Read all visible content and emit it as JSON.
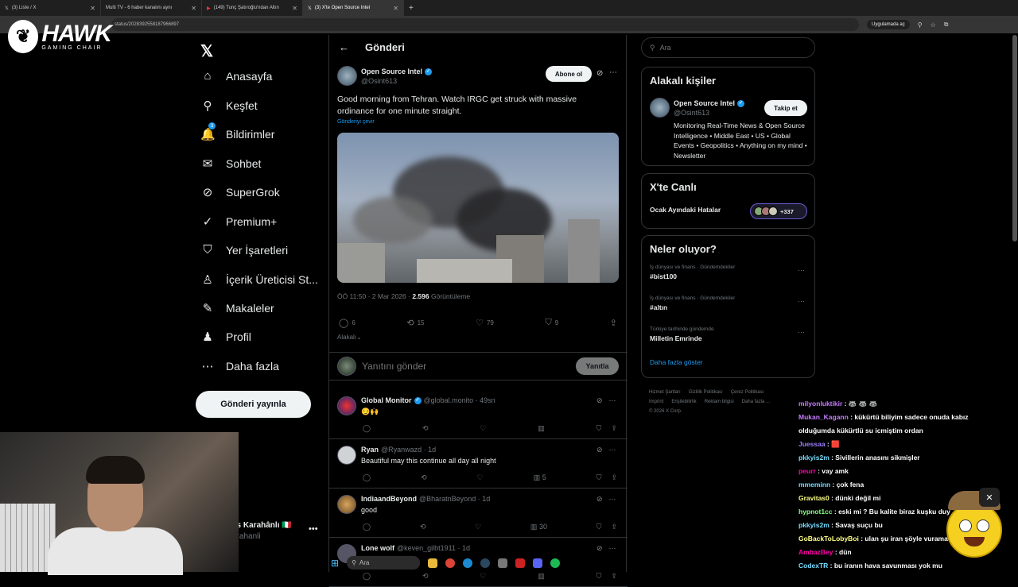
{
  "browser": {
    "tabs": [
      {
        "label": "(3) Liste / X",
        "active": false
      },
      {
        "label": "Multi TV - 6 haber kanalını aynı",
        "active": false
      },
      {
        "label": "(149) Tunç Şatıroğlu'ndan Altın",
        "active": false
      },
      {
        "label": "(3) X'te Open Source Intel",
        "active": true
      }
    ],
    "url": "status/2028392558187966897",
    "app_pill": "Uygulamada aç"
  },
  "overlay": {
    "brand_name": "HAWK",
    "brand_sub": "GAMING CHAIR",
    "close_glyph": "✕"
  },
  "nav": {
    "items": [
      {
        "label": "Anasayfa",
        "icon": "home-icon",
        "glyph": "⌂"
      },
      {
        "label": "Keşfet",
        "icon": "search-icon",
        "glyph": "⚲"
      },
      {
        "label": "Bildirimler",
        "icon": "bell-icon",
        "glyph": "🔔",
        "badge": "3"
      },
      {
        "label": "Sohbet",
        "icon": "mail-icon",
        "glyph": "✉"
      },
      {
        "label": "SuperGrok",
        "icon": "grok-icon",
        "glyph": "⊘"
      },
      {
        "label": "Premium+",
        "icon": "verified-icon",
        "glyph": "✓"
      },
      {
        "label": "Yer İşaretleri",
        "icon": "bookmark-icon",
        "glyph": "⛉"
      },
      {
        "label": "İçerik Üreticisi St...",
        "icon": "creator-icon",
        "glyph": "♙"
      },
      {
        "label": "Makaleler",
        "icon": "article-icon",
        "glyph": "✎"
      },
      {
        "label": "Profil",
        "icon": "user-icon",
        "glyph": "♟"
      },
      {
        "label": "Daha fazla",
        "icon": "more-circle-icon",
        "glyph": "⋯"
      }
    ],
    "post_button": "Gönderi yayınla",
    "account_name": "vs Karahânlı 🇮🇹",
    "account_handle": "arahanli"
  },
  "main": {
    "header_title": "Gönderi",
    "tweet": {
      "name": "Open Source Intel",
      "handle": "@Osint613",
      "subscribe": "Abone ol",
      "text": "Good morning from Tehran. Watch  IRGC get struck with massive ordinance for one minute straight.",
      "translate": "Gönderiyi çevir",
      "time": "ÖÖ 11:50 · 2 Mar 2026 · ",
      "views": "2.596",
      "views_label": " Görüntüleme",
      "replies": "6",
      "reposts": "15",
      "likes": "79",
      "bookmarks": "9",
      "relevance": "Alakalı⌄"
    },
    "reply_placeholder": "Yanıtını gönder",
    "reply_button": "Yanıtla",
    "replies": [
      {
        "name": "Global Monitor",
        "verified": true,
        "handle": "@global.monito · 49sn",
        "text": "😏🙌",
        "views": ""
      },
      {
        "name": "Ryan",
        "verified": false,
        "handle": "@Ryanwazd · 1d",
        "text": "Beautiful may this continue all day all night",
        "views": "5"
      },
      {
        "name": "IndiaandBeyond",
        "verified": false,
        "handle": "@BharatnBeyond · 1d",
        "text": "good",
        "views": "30"
      },
      {
        "name": "Lone wolf",
        "verified": false,
        "handle": "@keven_gilbt1911 · 1d",
        "text": "",
        "views": ""
      }
    ]
  },
  "right": {
    "search_placeholder": "Ara",
    "related": {
      "title": "Alakalı kişiler",
      "name": "Open Source Intel",
      "handle": "@Osint613",
      "follow": "Takip et",
      "bio": "Monitoring Real-Time News & Open Source Intelligence • Middle East • US • Global Events • Geopolitics • Anything on my mind • Newsletter"
    },
    "live": {
      "title": "X'te Canlı",
      "item": "Ocak Ayındaki Hatalar",
      "count": "+337"
    },
    "trends": {
      "title": "Neler oluyor?",
      "items": [
        {
          "category": "İş dünyası ve finans · Gündemdekiler",
          "name": "#bist100"
        },
        {
          "category": "İş dünyası ve finans · Gündemdekiler",
          "name": "#altın"
        },
        {
          "category": "Türkiye tarihinde gündemde",
          "name": "Milletin Emrinde"
        }
      ],
      "show_more": "Daha fazla göster"
    },
    "footer": [
      "Hizmet Şartları",
      "Gizlilik Politikası",
      "Çerez Politikası",
      "Imprint",
      "Erişilebilirlik",
      "Reklam bilgisi",
      "Daha fazla ...",
      "© 2026 X Corp."
    ]
  },
  "chat": [
    {
      "user": "milyonluktikir",
      "msg": " : 🦝 🦝 🦝"
    },
    {
      "user": "Mukan_Kagann",
      "msg": " : kükürtü biliyim sadece onuda kabız"
    },
    {
      "user": "",
      "msg": "olduğumda kükürtlü su icmiştim ordan"
    },
    {
      "user": "Juessaa",
      "msg": " : 🟥"
    },
    {
      "user": "pkkyis2m",
      "msg": " : Sivillerin anasını sikmişler"
    },
    {
      "user": "peurr",
      "msg": " : vay amk"
    },
    {
      "user": "mmeminn",
      "msg": " : çok fena"
    },
    {
      "user": "Gravitas0",
      "msg": " : dünki değil mi"
    },
    {
      "user": "hypnot1cc",
      "msg": " : eski mi ? Bu kalite biraz kuşku duy"
    },
    {
      "user": "pkkyis2m",
      "msg": " : Savaş suçu bu"
    },
    {
      "user": "GoBackToLobyBoi",
      "msg": " : ulan şu iran şöyle vuramadı amk israili ya"
    },
    {
      "user": "AmbazBey",
      "msg": " : dün"
    },
    {
      "user": "CodexTR",
      "msg": " : bu iranın hava savunması yok mu"
    }
  ],
  "taskbar": {
    "search": "Ara"
  },
  "colors": {
    "accent": "#1d9bf0",
    "bg": "#000000",
    "border": "#2f3336",
    "muted": "#71767b"
  }
}
